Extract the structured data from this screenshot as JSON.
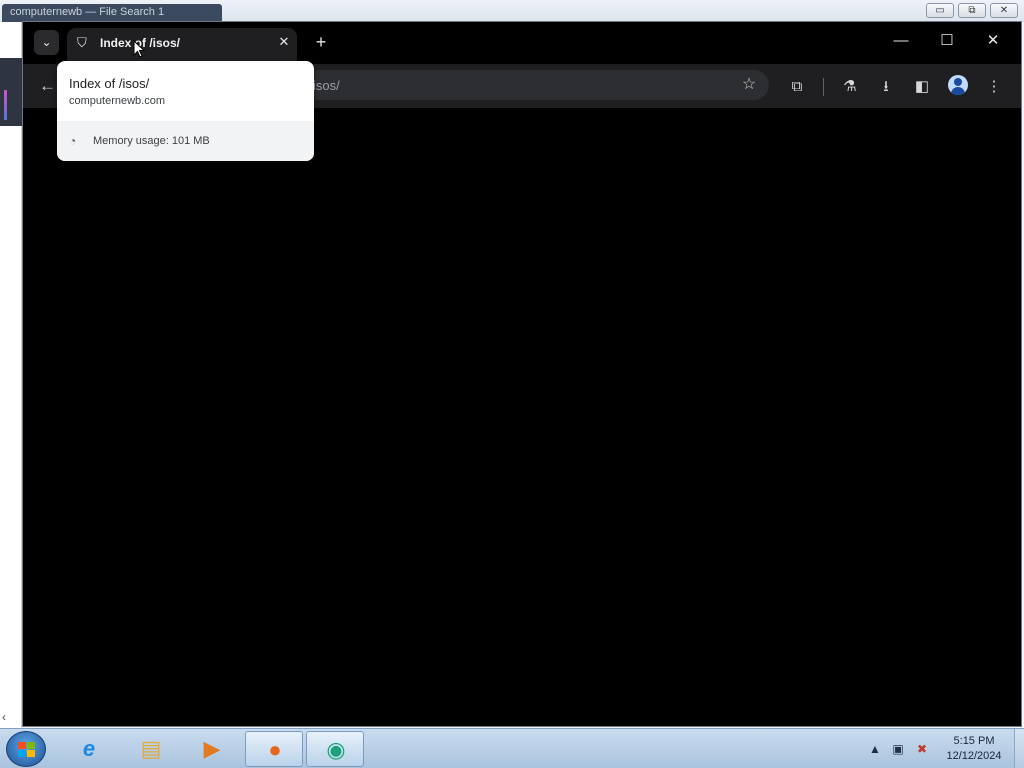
{
  "background_window": {
    "tab_label": "computernewb — File Search 1",
    "controls": [
      "▭",
      "⧉",
      "✕"
    ]
  },
  "browser": {
    "tab_search_glyph": "⌄",
    "active_tab": {
      "title": "Index of /isos/",
      "close_glyph": "✕"
    },
    "new_tab_glyph": "+",
    "window_controls": {
      "minimize": "—",
      "maximize": "☐",
      "close": "✕"
    },
    "omnibox_text": "isos/",
    "back_glyph": "←",
    "star_glyph": "☆",
    "toolbar_icons": {
      "extensions": "⧉",
      "labs": "⚗",
      "downloads": "⭳",
      "side_panel": "◧",
      "menu": "⋮"
    }
  },
  "hover_card": {
    "title": "Index of /isos/",
    "domain": "computernewb.com",
    "memory_usage": "Memory usage: 101 MB"
  },
  "taskbar": {
    "clock_time": "5:15 PM",
    "clock_date": "12/12/2024",
    "tray_arrow": "▲",
    "apps": [
      {
        "name": "internet-explorer",
        "glyph": "e",
        "color": "#1e88e5"
      },
      {
        "name": "file-explorer",
        "glyph": "▤",
        "color": "#e0a93a"
      },
      {
        "name": "media-player",
        "glyph": "▶",
        "color": "#e07b22"
      },
      {
        "name": "firefox",
        "glyph": "●",
        "color": "#e8641b"
      },
      {
        "name": "chromium-browser",
        "glyph": "◉",
        "color": "#1aa37a"
      }
    ]
  },
  "colors": {
    "page_background": "#000000",
    "tab_background": "#1f1f22",
    "omnibox": "#2d2e31",
    "hovercard_bg": "#ffffff"
  }
}
